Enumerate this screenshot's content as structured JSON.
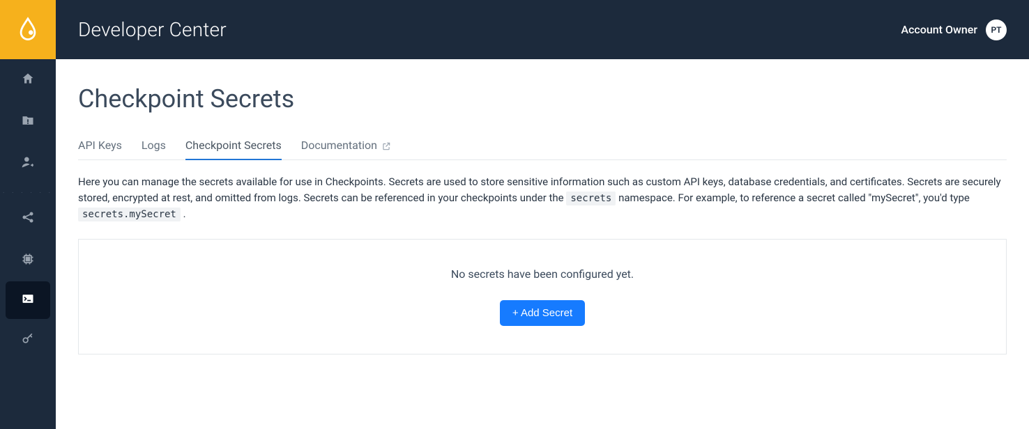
{
  "header": {
    "title": "Developer Center",
    "account_label": "Account Owner",
    "avatar_initials": "PT"
  },
  "sidebar": {
    "divider": ". . . . . ."
  },
  "page": {
    "title": "Checkpoint Secrets"
  },
  "tabs": {
    "api_keys": "API Keys",
    "logs": "Logs",
    "checkpoint_secrets": "Checkpoint Secrets",
    "documentation": "Documentation"
  },
  "description": {
    "part1": "Here you can manage the secrets available for use in Checkpoints. Secrets are used to store sensitive information such as custom API keys, database credentials, and certificates. Secrets are securely stored, encrypted at rest, and omitted from logs. Secrets can be referenced in your checkpoints under the ",
    "code1": "secrets",
    "part2": " namespace. For example, to reference a secret called \"mySecret\", you'd type ",
    "code2": "secrets.mySecret",
    "part3": "."
  },
  "panel": {
    "empty_message": "No secrets have been configured yet.",
    "add_button": "+ Add Secret"
  }
}
